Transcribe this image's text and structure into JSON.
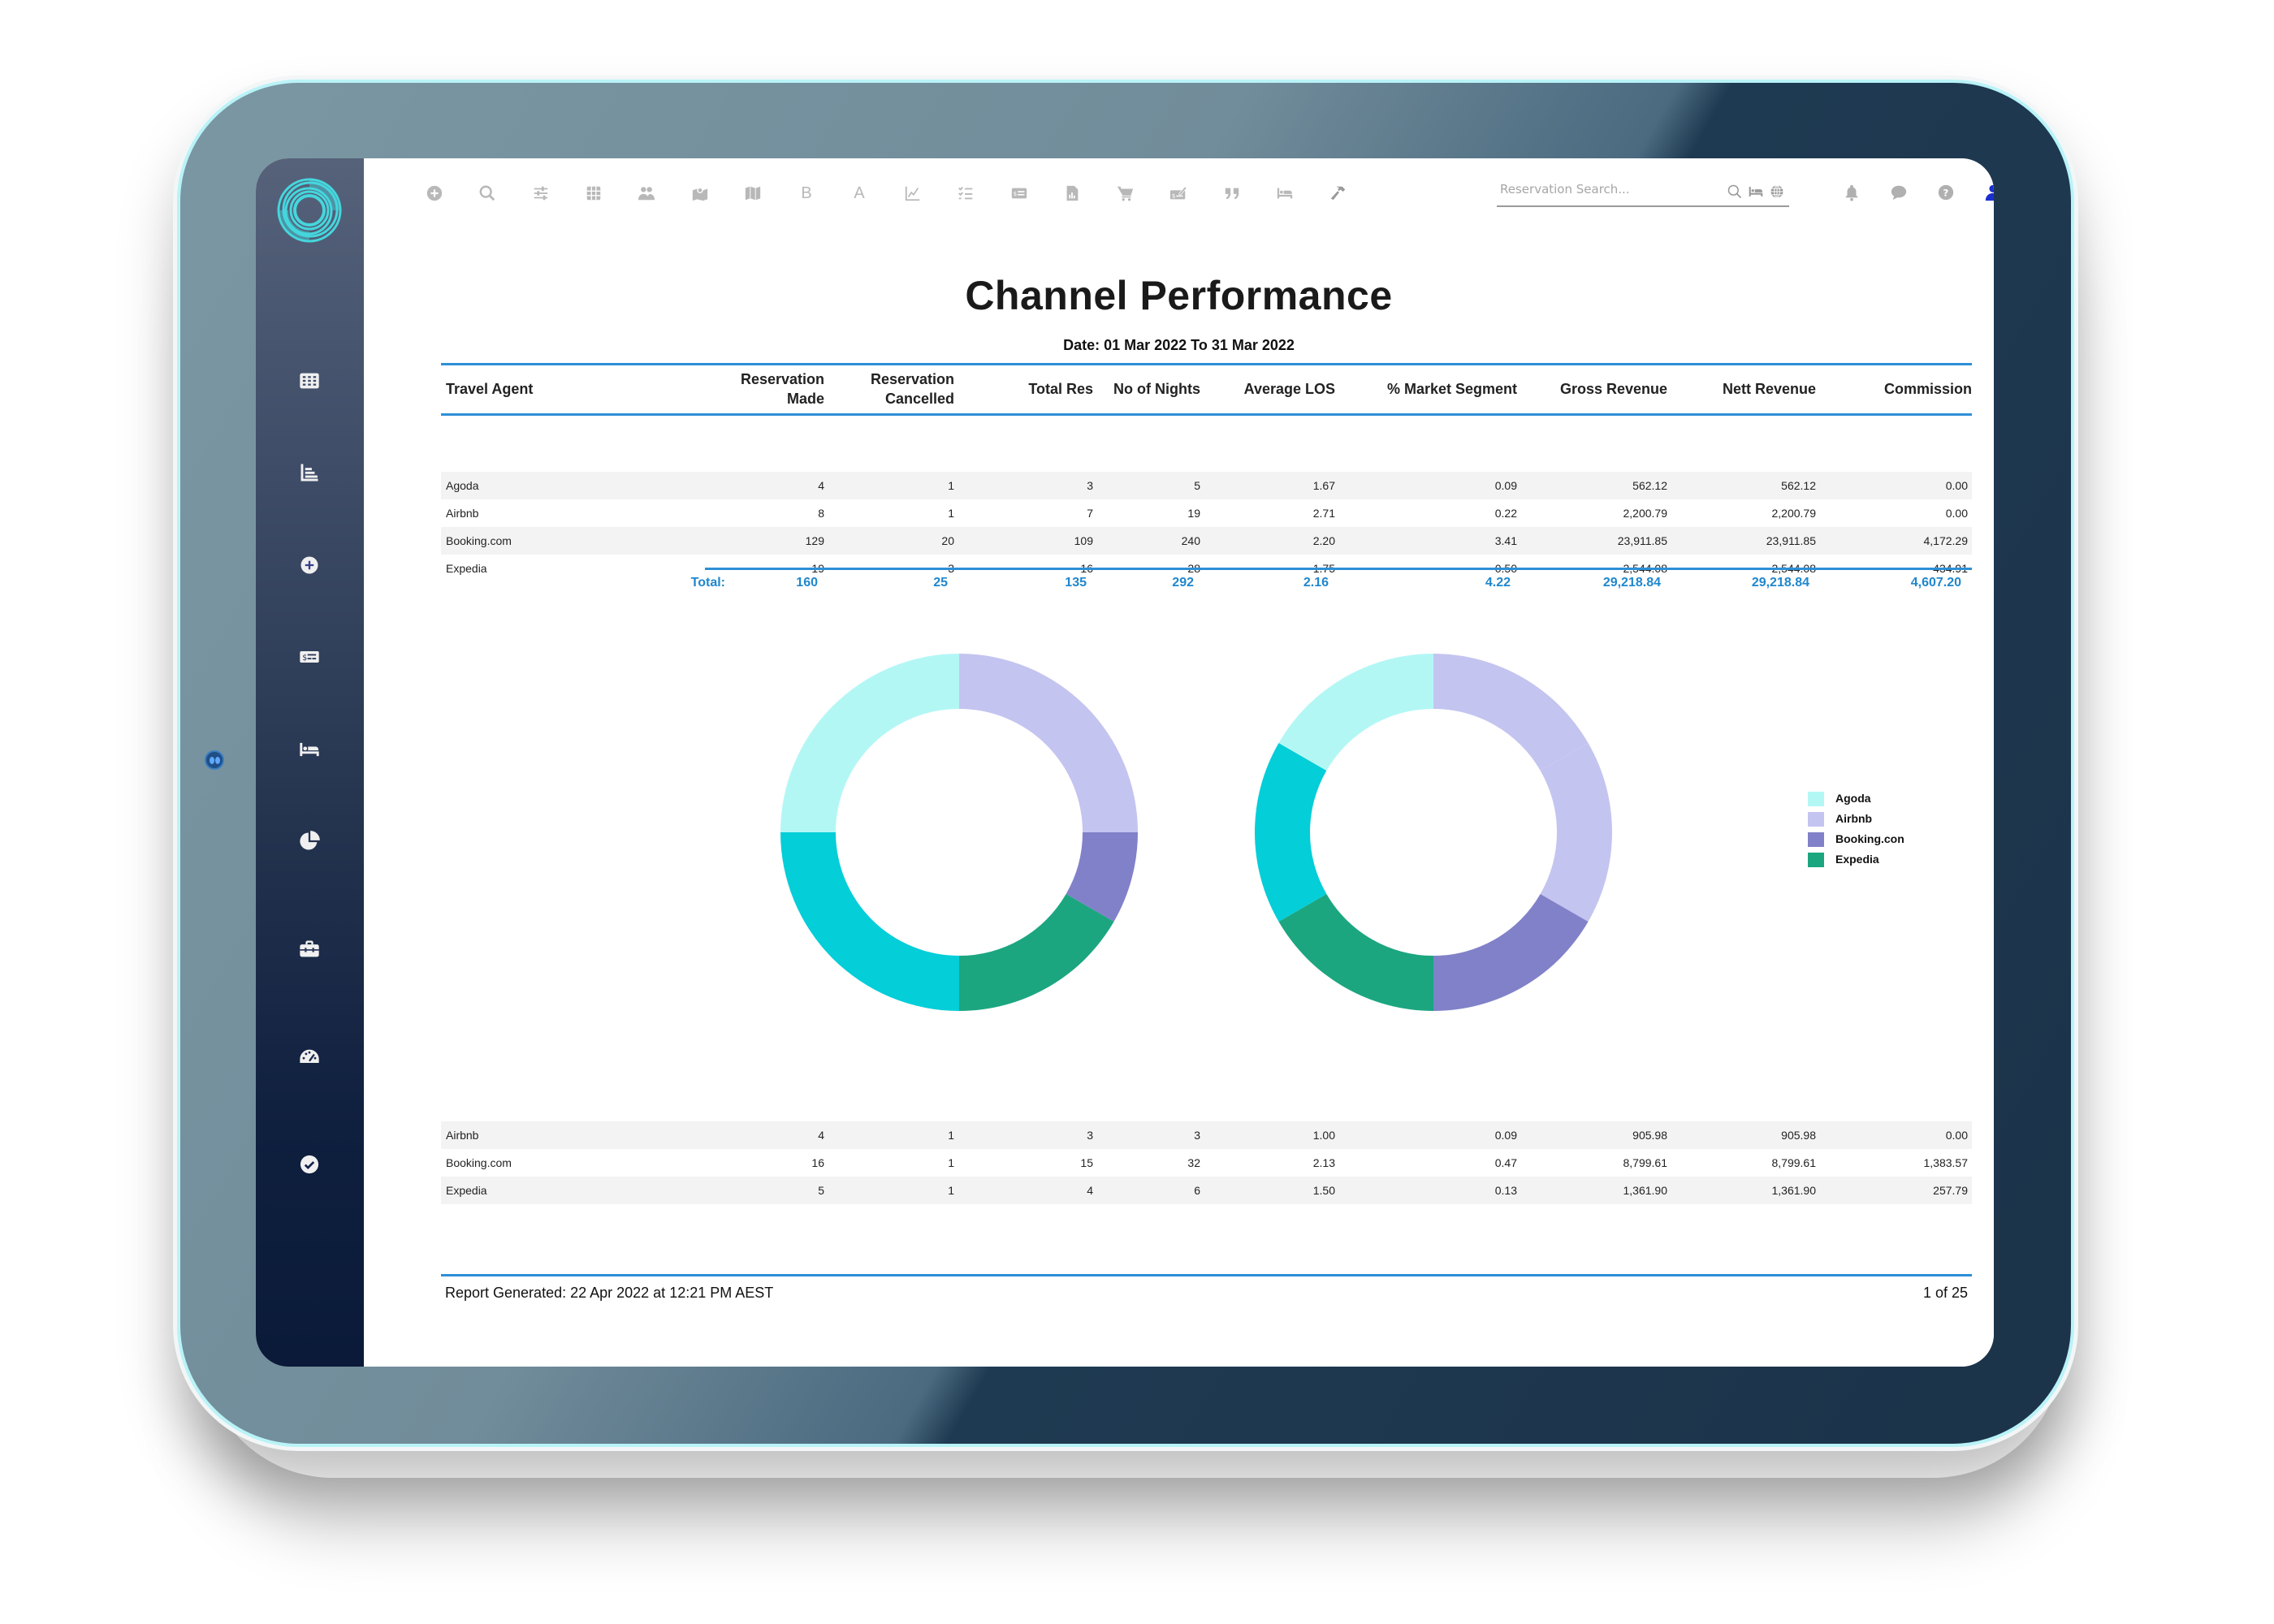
{
  "toolbar": {
    "icons": [
      "plus-circle-icon",
      "search-icon",
      "sliders-icon",
      "grid-icon",
      "users-icon",
      "map-pin-icon",
      "map-icon",
      "bold-icon",
      "font-icon",
      "line-chart-icon",
      "checklist-icon",
      "money-card-icon",
      "file-chart-icon",
      "cart-icon",
      "check-edit-icon",
      "quote-icon",
      "bed-icon",
      "hammer-icon"
    ],
    "bold_letter": "B",
    "font_letter": "A"
  },
  "search": {
    "placeholder": "Reservation Search...",
    "value": ""
  },
  "sidebar": {
    "items": [
      {
        "icon": "calendar-grid-icon"
      },
      {
        "icon": "bar-chart-icon"
      },
      {
        "icon": "add-circle-icon"
      },
      {
        "icon": "rate-card-icon"
      },
      {
        "icon": "bed-icon"
      },
      {
        "icon": "pie-chart-icon"
      },
      {
        "icon": "toolbox-icon"
      },
      {
        "icon": "dashboard-gauge-icon"
      },
      {
        "icon": "check-circle-icon"
      }
    ]
  },
  "report": {
    "title": "Channel Performance",
    "date_range": "Date: 01 Mar 2022 To 31 Mar 2022",
    "columns": [
      "Travel Agent",
      "Reservation\nMade",
      "Reservation\nCancelled",
      "Total Res",
      "No of Nights",
      "Average LOS",
      "% Market Segment",
      "Gross Revenue",
      "Nett Revenue",
      "Commission"
    ],
    "columns_display": {
      "travel_agent": "Travel Agent",
      "res_made_1": "Reservation",
      "res_made_2": "Made",
      "res_cancelled_1": "Reservation",
      "res_cancelled_2": "Cancelled",
      "total_res": "Total Res",
      "nights": "No of Nights",
      "avg_los": "Average LOS",
      "market_segment": "% Market Segment",
      "gross_revenue": "Gross Revenue",
      "nett_revenue": "Nett Revenue",
      "commission": "Commission"
    },
    "group1": [
      [
        "Agoda",
        "4",
        "1",
        "3",
        "5",
        "1.67",
        "0.09",
        "562.12",
        "562.12",
        "0.00"
      ],
      [
        "Airbnb",
        "8",
        "1",
        "7",
        "19",
        "2.71",
        "0.22",
        "2,200.79",
        "2,200.79",
        "0.00"
      ],
      [
        "Booking.com",
        "129",
        "20",
        "109",
        "240",
        "2.20",
        "3.41",
        "23,911.85",
        "23,911.85",
        "4,172.29"
      ],
      [
        "Expedia",
        "19",
        "3",
        "16",
        "28",
        "1.75",
        "0.50",
        "2,544.08",
        "2,544.08",
        "434.91"
      ]
    ],
    "total": [
      "Total:",
      "160",
      "25",
      "135",
      "292",
      "2.16",
      "4.22",
      "29,218.84",
      "29,218.84",
      "4,607.20"
    ],
    "group2": [
      [
        "Airbnb",
        "4",
        "1",
        "3",
        "3",
        "1.00",
        "0.09",
        "905.98",
        "905.98",
        "0.00"
      ],
      [
        "Booking.com",
        "16",
        "1",
        "15",
        "32",
        "2.13",
        "0.47",
        "8,799.61",
        "8,799.61",
        "1,383.57"
      ],
      [
        "Expedia",
        "5",
        "1",
        "4",
        "6",
        "1.50",
        "0.13",
        "1,361.90",
        "1,361.90",
        "257.79"
      ]
    ],
    "footer_generated": "Report Generated: 22 Apr 2022 at 12:21 PM AEST",
    "footer_page": "1 of 25"
  },
  "chart_data": [
    {
      "type": "pie",
      "title": "",
      "variant": "donut",
      "start": "top, clockwise",
      "slices": [
        {
          "label": "Airbnb",
          "value": 3,
          "color": "#c4c4f0"
        },
        {
          "label": "Booking.com",
          "value": 1,
          "color": "#8181c9"
        },
        {
          "label": "Expedia",
          "value": 2,
          "color": "#1ba680"
        },
        {
          "label": "(unlabeled)",
          "value": 3,
          "color": "#04ced8"
        },
        {
          "label": "Agoda",
          "value": 3,
          "color": "#b3f7f5"
        }
      ]
    },
    {
      "type": "pie",
      "title": "",
      "variant": "donut",
      "start": "top, clockwise",
      "slices": [
        {
          "label": "Airbnb",
          "value": 1,
          "color": "#c4c4f0"
        },
        {
          "label": "Airbnb",
          "value": 1,
          "color": "#c4c4f0"
        },
        {
          "label": "Booking.com",
          "value": 1,
          "color": "#8181c9"
        },
        {
          "label": "Expedia",
          "value": 1,
          "color": "#1ba680"
        },
        {
          "label": "(unlabeled)",
          "value": 1,
          "color": "#04ced8"
        },
        {
          "label": "Agoda",
          "value": 1,
          "color": "#b3f7f5"
        }
      ]
    }
  ],
  "legend": {
    "placement": "right",
    "items": [
      {
        "label": "Agoda",
        "color": "#b3f7f5"
      },
      {
        "label": "Airbnb",
        "color": "#c4c4f0"
      },
      {
        "label": "Booking.con",
        "color": "#8181c9"
      },
      {
        "label": "Expedia",
        "color": "#1ba680"
      }
    ]
  },
  "colors": {
    "accent_blue": "#2e8fd6",
    "total_text": "#1f87cd",
    "logo_cyan": "#45d6dd",
    "user_icon": "#1a2fd1",
    "icon_gray": "#b3b3b3"
  }
}
